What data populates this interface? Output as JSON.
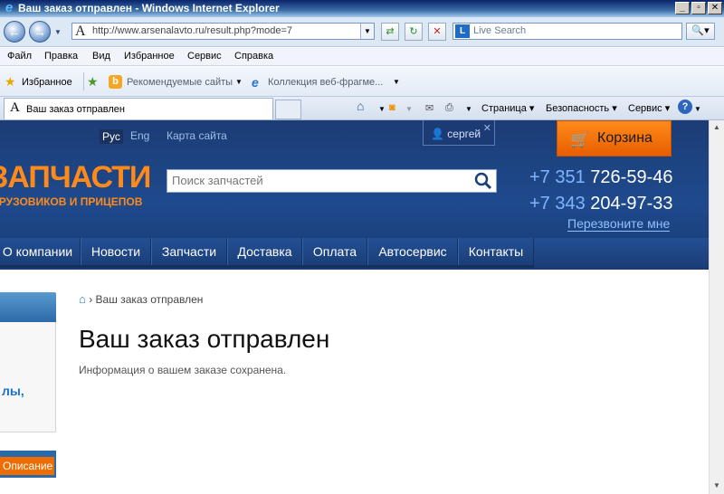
{
  "window": {
    "title": "Ваш заказ отправлен - Windows Internet Explorer"
  },
  "browser": {
    "address_url": "http://www.arsenalavto.ru/result.php?mode=7",
    "search_placeholder": "Live Search",
    "menu": [
      "Файл",
      "Правка",
      "Вид",
      "Избранное",
      "Сервис",
      "Справка"
    ],
    "favorites_label": "Избранное",
    "fav_recommended": "Рекомендуемые сайты",
    "fav_gallery": "Коллекция веб-фрагме...",
    "tab_title": "Ваш заказ отправлен",
    "cmd_page": "Страница",
    "cmd_security": "Безопасность",
    "cmd_tools": "Сервис"
  },
  "site": {
    "lang_ru": "Рус",
    "lang_en": "Eng",
    "sitemap": "Карта сайта",
    "user": "сергей",
    "cart": "Корзина",
    "logo_main": "ЗАПЧАСТИ",
    "logo_sub": "ГРУЗОВИКОВ И ПРИЦЕПОВ",
    "search_placeholder": "Поиск запчастей",
    "phone1_code": "+7 351",
    "phone1_num": "726-59-46",
    "phone2_code": "+7 343",
    "phone2_num": "204-97-33",
    "callback": "Перезвоните мне",
    "nav": [
      "О компании",
      "Новости",
      "Запчасти",
      "Доставка",
      "Оплата",
      "Автосервис",
      "Контакты"
    ],
    "breadcrumb_current": "Ваш заказ отправлен",
    "page_title": "Ваш заказ отправлен",
    "info_text": "Информация о вашем заказе сохранена.",
    "side_link": "лы,",
    "side_tab": "Описание"
  }
}
